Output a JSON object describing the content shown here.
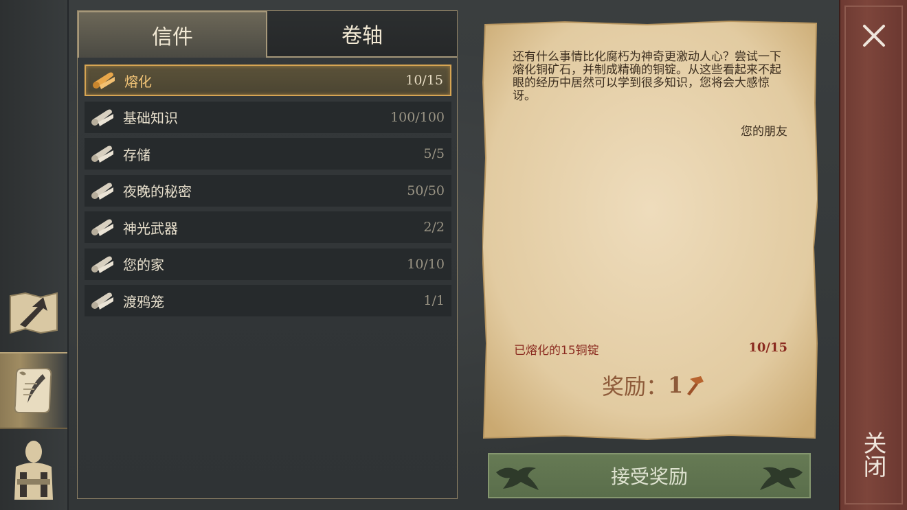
{
  "tabs": {
    "letters": "信件",
    "scrolls": "卷轴"
  },
  "letters": [
    {
      "label": "熔化",
      "progress": "10/15",
      "selected": true
    },
    {
      "label": "基础知识",
      "progress": "100/100"
    },
    {
      "label": "存储",
      "progress": "5/5"
    },
    {
      "label": "夜晚的秘密",
      "progress": "50/50"
    },
    {
      "label": "神光武器",
      "progress": "2/2"
    },
    {
      "label": "您的家",
      "progress": "10/10"
    },
    {
      "label": "渡鸦笼",
      "progress": "1/1"
    }
  ],
  "letter_detail": {
    "body": "还有什么事情比化腐朽为神奇更激动人心？尝试一下熔化铜矿石，并制成精确的铜锭。从这些看起来不起眼的经历中居然可以学到很多知识，您将会大感惊讶。",
    "signature": "您的朋友",
    "task_label": "已熔化的15铜锭",
    "task_progress": "10/15",
    "reward_label": "奖励：",
    "reward_value": "1"
  },
  "accept_button": "接受奖励",
  "close_label": "关闭",
  "colors": {
    "selected_border": "#d7a553",
    "task_red": "#8a2a1f",
    "close_bar": "#7d453b",
    "accept_green": "#667a54"
  },
  "icons": {
    "row_icon": "scroll-icon",
    "rail": [
      "map-arrow-icon",
      "letter-quill-icon",
      "character-icon"
    ],
    "close": "close-x-icon",
    "reward": "hammer-icon"
  }
}
